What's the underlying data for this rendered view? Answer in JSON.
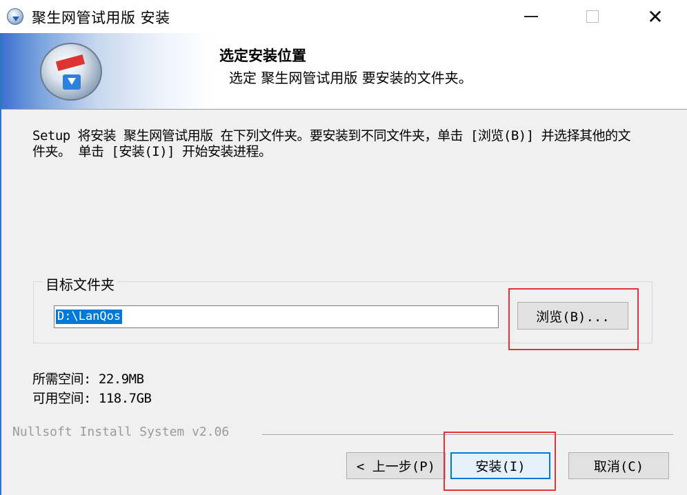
{
  "window": {
    "title": "聚生网管试用版 安装"
  },
  "header": {
    "title": "选定安装位置",
    "subtitle": "选定 聚生网管试用版 要安装的文件夹。"
  },
  "body": {
    "description": "Setup 将安装 聚生网管试用版 在下列文件夹。要安装到不同文件夹，单击 [浏览(B)] 并选择其他的文件夹。 单击 [安装(I)] 开始安装进程。",
    "destination_group_label": "目标文件夹",
    "destination_path": "D:\\LanQos",
    "browse_label": "浏览(B)...",
    "space_required": "所需空间: 22.9MB",
    "space_available": "可用空间: 118.7GB"
  },
  "footer": {
    "branding": "Nullsoft Install System v2.06",
    "back_label": "< 上一步(P)",
    "install_label": "安装(I)",
    "cancel_label": "取消(C)"
  },
  "colors": {
    "highlight": "#e5323a",
    "selection": "#0078d7",
    "dialog_bg": "#f0f0f0"
  },
  "icons": [
    "installer-app-icon",
    "minimize-icon",
    "maximize-icon",
    "close-icon",
    "installer-disc-icon"
  ]
}
